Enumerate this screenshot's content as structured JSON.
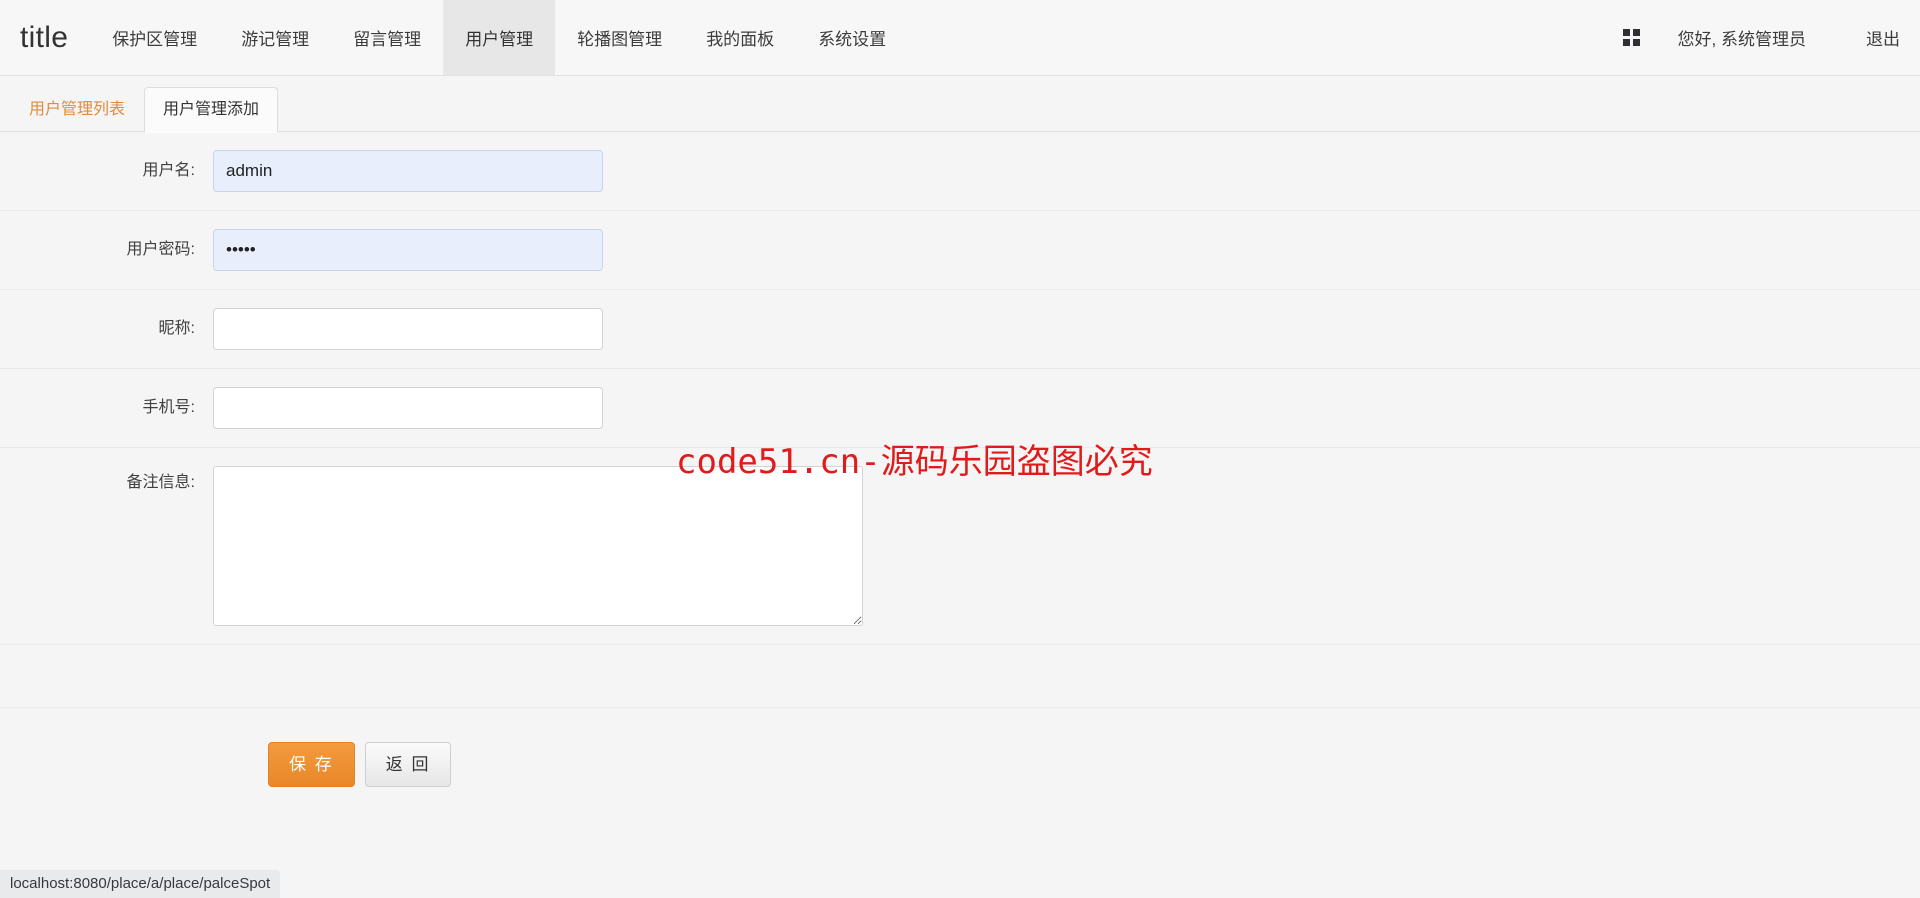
{
  "header": {
    "brand": "title",
    "nav_items": [
      {
        "label": "保护区管理",
        "active": false
      },
      {
        "label": "游记管理",
        "active": false
      },
      {
        "label": "留言管理",
        "active": false
      },
      {
        "label": "用户管理",
        "active": true
      },
      {
        "label": "轮播图管理",
        "active": false
      },
      {
        "label": "我的面板",
        "active": false
      },
      {
        "label": "系统设置",
        "active": false
      }
    ],
    "grid_icon": "grid-icon",
    "greeting": "您好, 系统管理员",
    "logout": "退出"
  },
  "tabs": [
    {
      "label": "用户管理列表",
      "active": false
    },
    {
      "label": "用户管理添加",
      "active": true
    }
  ],
  "form": {
    "fields": [
      {
        "label": "用户名:",
        "type": "text",
        "value": "admin",
        "placeholder": "",
        "autofilled": true,
        "name": "username"
      },
      {
        "label": "用户密码:",
        "type": "password",
        "value": "•••••",
        "placeholder": "",
        "autofilled": true,
        "name": "password"
      },
      {
        "label": "昵称:",
        "type": "text",
        "value": "",
        "placeholder": "",
        "autofilled": false,
        "name": "nickname"
      },
      {
        "label": "手机号:",
        "type": "text",
        "value": "",
        "placeholder": "",
        "autofilled": false,
        "name": "phone"
      }
    ],
    "textarea": {
      "label": "备注信息:",
      "value": "",
      "placeholder": "",
      "name": "remark"
    }
  },
  "actions": {
    "save_label": "保 存",
    "back_label": "返 回"
  },
  "watermark": "code51.cn-源码乐园盗图必究",
  "status_bar": "localhost:8080/place/a/place/palceSpot",
  "colors": {
    "accent_orange": "#ef8f2c",
    "tab_link_orange": "#e08b3f",
    "watermark_red": "#e01b1b",
    "autofill_blue": "#e8eefb",
    "page_bg": "#f5f5f5",
    "navbar_bg": "#f7f7f7"
  }
}
